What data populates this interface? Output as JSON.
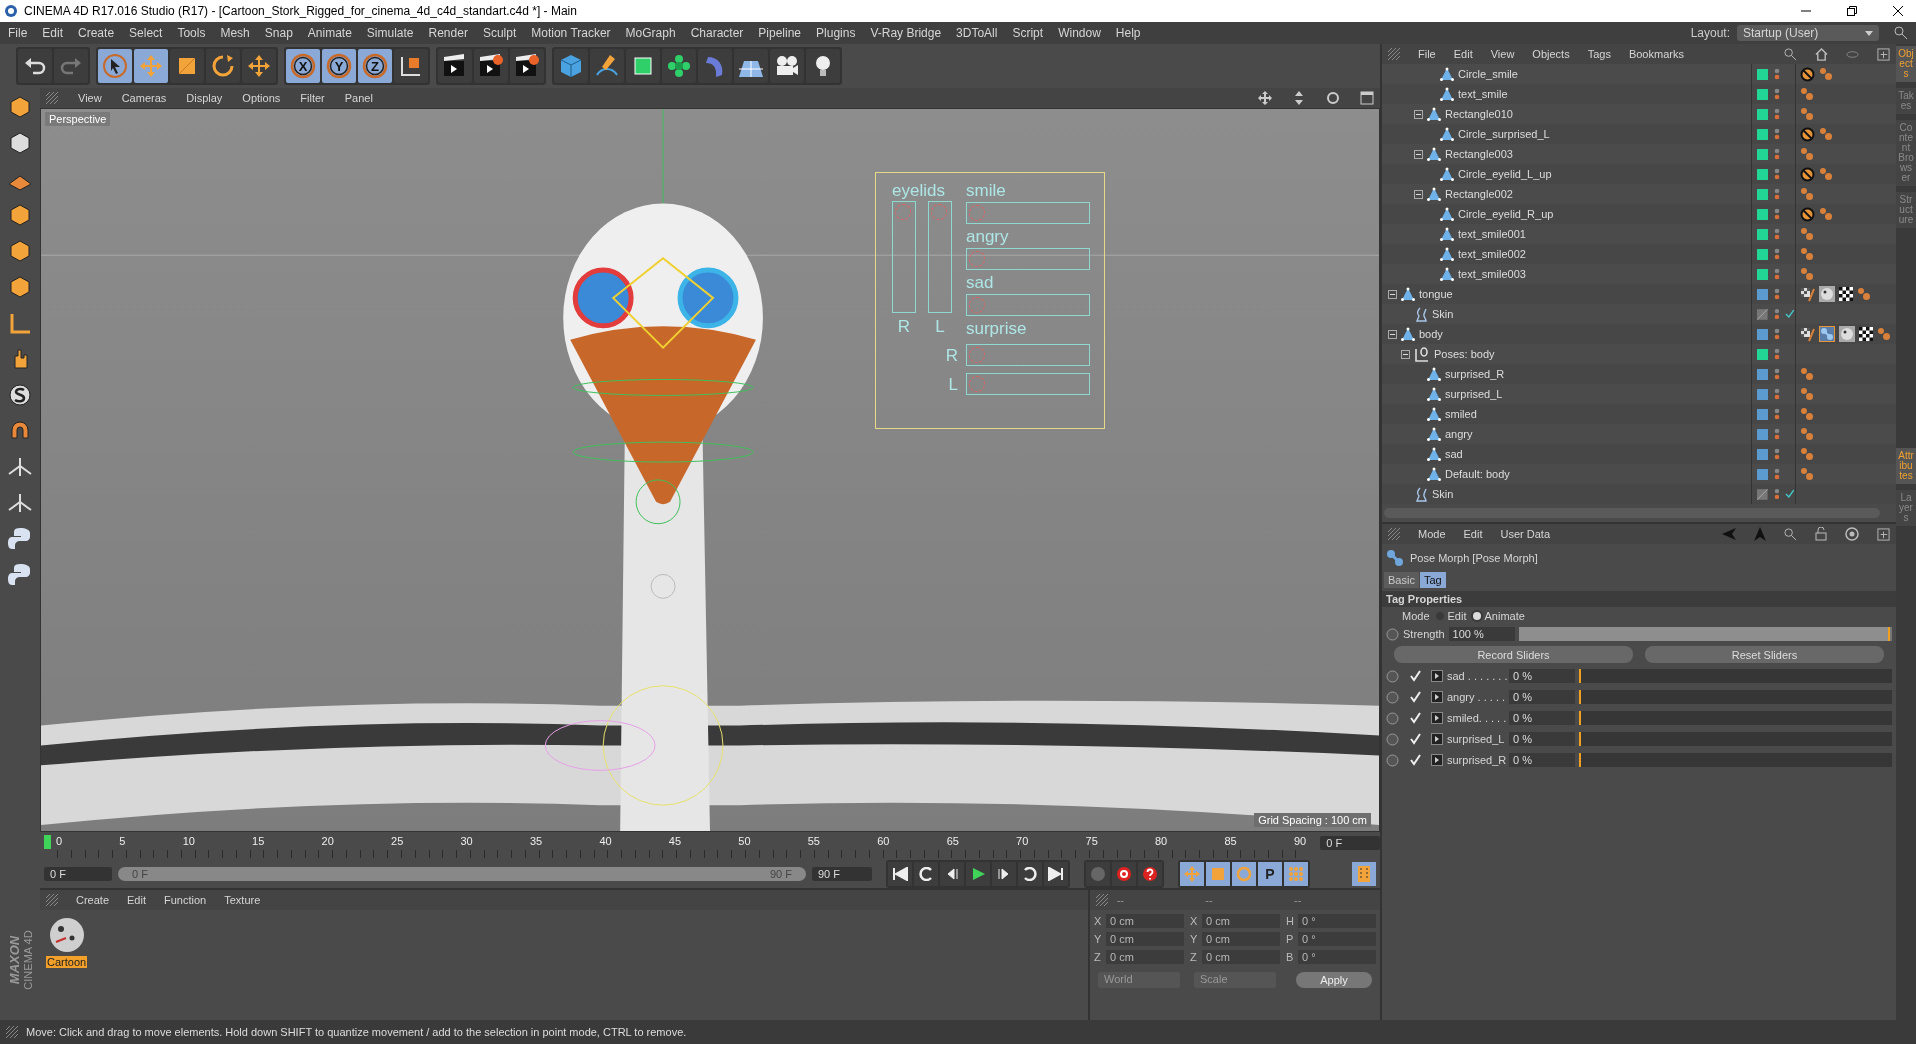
{
  "window": {
    "title": "CINEMA 4D R17.016 Studio (R17) - [Cartoon_Stork_Rigged_for_cinema_4d_c4d_standart.c4d *] - Main"
  },
  "menu_bar": [
    "File",
    "Edit",
    "Create",
    "Select",
    "Tools",
    "Mesh",
    "Snap",
    "Animate",
    "Simulate",
    "Render",
    "Sculpt",
    "Motion Tracker",
    "MoGraph",
    "Character",
    "Pipeline",
    "Plugins",
    "V-Ray Bridge",
    "3DToAll",
    "Script",
    "Window",
    "Help"
  ],
  "layout": {
    "label": "Layout:",
    "value": "Startup (User)"
  },
  "toolbar": [
    [
      {
        "kind": "undo",
        "selected": false
      },
      {
        "kind": "redo",
        "selected": false
      }
    ],
    [
      {
        "kind": "select",
        "selected": true
      },
      {
        "kind": "move",
        "selected": true
      },
      {
        "kind": "scale",
        "selected": false
      },
      {
        "kind": "rotate",
        "selected": false
      },
      {
        "kind": "move-alt",
        "selected": false
      }
    ],
    [
      {
        "kind": "axis",
        "label": "X",
        "selected": true
      },
      {
        "kind": "axis",
        "label": "Y",
        "selected": true
      },
      {
        "kind": "axis",
        "label": "Z",
        "selected": true
      },
      {
        "kind": "coords",
        "selected": false
      }
    ],
    [
      {
        "kind": "render-view",
        "selected": false
      },
      {
        "kind": "render",
        "selected": false
      },
      {
        "kind": "render-settings",
        "selected": false
      }
    ],
    [
      {
        "kind": "cube",
        "selected": false
      },
      {
        "kind": "pen",
        "selected": false
      },
      {
        "kind": "generator",
        "selected": false
      },
      {
        "kind": "array",
        "selected": false
      },
      {
        "kind": "deformer",
        "selected": false
      },
      {
        "kind": "floor",
        "selected": false
      },
      {
        "kind": "camera",
        "selected": false
      },
      {
        "kind": "light",
        "selected": false
      }
    ]
  ],
  "viewport": {
    "menu": [
      "View",
      "Cameras",
      "Display",
      "Options",
      "Filter",
      "Panel"
    ],
    "camera": "Perspective",
    "grid_spacing": "Grid Spacing : 100 cm",
    "controller": {
      "eyelids": "eyelids",
      "eyelid_sides": [
        "R",
        "L"
      ],
      "sliders": [
        "smile",
        "angry",
        "sad"
      ],
      "surprise": "surprise",
      "surprise_sides": [
        "R",
        "L"
      ]
    }
  },
  "timeline": {
    "ticks": [
      "0",
      "5",
      "10",
      "15",
      "20",
      "25",
      "30",
      "35",
      "40",
      "45",
      "50",
      "55",
      "60",
      "65",
      "70",
      "75",
      "80",
      "85",
      "90"
    ],
    "current": "0 F",
    "start": "0 F",
    "range": {
      "start": "0 F",
      "end": "90 F"
    },
    "end": "90 F",
    "key_param": "P"
  },
  "materials": {
    "menu": [
      "Create",
      "Edit",
      "Function",
      "Texture"
    ],
    "items": [
      {
        "name": "Cartoon",
        "selected": true
      }
    ]
  },
  "coordinates": {
    "headers": [
      "--",
      "--",
      "--"
    ],
    "rows": [
      [
        {
          "axis": "X",
          "value": "0 cm"
        },
        {
          "axis": "X",
          "value": "0 cm"
        },
        {
          "axis": "H",
          "value": "0 °"
        }
      ],
      [
        {
          "axis": "Y",
          "value": "0 cm"
        },
        {
          "axis": "Y",
          "value": "0 cm"
        },
        {
          "axis": "P",
          "value": "0 °"
        }
      ],
      [
        {
          "axis": "Z",
          "value": "0 cm"
        },
        {
          "axis": "Z",
          "value": "0 cm"
        },
        {
          "axis": "B",
          "value": "0 °"
        }
      ]
    ],
    "dropdowns": [
      "World",
      "Scale"
    ],
    "apply": "Apply"
  },
  "logo": {
    "line1": "MAXON",
    "line2": "CINEMA 4D"
  },
  "status_bar": "Move: Click and drag to move elements. Hold down SHIFT to quantize movement / add to the selection in point mode, CTRL to remove.",
  "object_manager": {
    "menu": [
      "File",
      "Edit",
      "View",
      "Objects",
      "Tags",
      "Bookmarks"
    ],
    "tree": [
      {
        "children": [
          {
            "children": [
              {
                "children": [
                  {
                    "name": "Circle_smile",
                    "kind": "polygon",
                    "color": "#22d796",
                    "tags": [
                      {
                        "kind": "restrict"
                      },
                      {
                        "kind": "dots"
                      }
                    ]
                  },
                  {
                    "name": "text_smile",
                    "kind": "polygon",
                    "color": "#22d796",
                    "tags": [
                      {
                        "kind": "dots"
                      }
                    ]
                  }
                ]
              },
              {
                "name": "Rectangle010",
                "kind": "polygon",
                "color": "#22d796",
                "tags": [
                  {
                    "kind": "dots"
                  }
                ],
                "children": [
                  {
                    "name": "Circle_surprised_L",
                    "kind": "polygon",
                    "color": "#22d796",
                    "tags": [
                      {
                        "kind": "restrict"
                      },
                      {
                        "kind": "dots"
                      }
                    ]
                  }
                ]
              },
              {
                "name": "Rectangle003",
                "kind": "polygon",
                "color": "#22d796",
                "tags": [
                  {
                    "kind": "dots"
                  }
                ],
                "children": [
                  {
                    "name": "Circle_eyelid_L_up",
                    "kind": "polygon",
                    "color": "#22d796",
                    "tags": [
                      {
                        "kind": "restrict"
                      },
                      {
                        "kind": "dots"
                      }
                    ]
                  }
                ]
              },
              {
                "name": "Rectangle002",
                "kind": "polygon",
                "color": "#22d796",
                "tags": [
                  {
                    "kind": "dots"
                  }
                ],
                "children": [
                  {
                    "name": "Circle_eyelid_R_up",
                    "kind": "polygon",
                    "color": "#22d796",
                    "tags": [
                      {
                        "kind": "restrict"
                      },
                      {
                        "kind": "dots"
                      }
                    ]
                  },
                  {
                    "name": "text_smile001",
                    "kind": "polygon",
                    "color": "#22d796",
                    "tags": [
                      {
                        "kind": "dots"
                      }
                    ]
                  },
                  {
                    "name": "text_smile002",
                    "kind": "polygon",
                    "color": "#22d796",
                    "tags": [
                      {
                        "kind": "dots"
                      }
                    ]
                  },
                  {
                    "name": "text_smile003",
                    "kind": "polygon",
                    "color": "#22d796",
                    "tags": [
                      {
                        "kind": "dots"
                      }
                    ]
                  }
                ]
              }
            ]
          }
        ]
      },
      {
        "name": "tongue",
        "kind": "polygon",
        "color": "#5b9bd0",
        "tags": [
          {
            "kind": "texture"
          },
          {
            "kind": "material"
          },
          {
            "kind": "checker"
          },
          {
            "kind": "dots"
          }
        ],
        "children": [
          {
            "name": "Skin",
            "kind": "skin"
          }
        ]
      },
      {
        "name": "body",
        "kind": "polygon",
        "color": "#5b9bd0",
        "tags": [
          {
            "kind": "texture"
          },
          {
            "kind": "posemorph"
          },
          {
            "kind": "material"
          },
          {
            "kind": "checker"
          },
          {
            "kind": "dots"
          }
        ],
        "children": [
          {
            "name": "Poses: body",
            "kind": "pose",
            "color": "#22d796",
            "children": [
              {
                "name": "surprised_R",
                "kind": "polygon",
                "color": "#5b9bd0",
                "tags": [
                  {
                    "kind": "dots"
                  }
                ]
              },
              {
                "name": "surprised_L",
                "kind": "polygon",
                "color": "#5b9bd0",
                "tags": [
                  {
                    "kind": "dots"
                  }
                ]
              },
              {
                "name": "smiled",
                "kind": "polygon",
                "color": "#5b9bd0",
                "tags": [
                  {
                    "kind": "dots"
                  }
                ]
              },
              {
                "name": "angry",
                "kind": "polygon",
                "color": "#5b9bd0",
                "tags": [
                  {
                    "kind": "dots"
                  }
                ]
              },
              {
                "name": "sad",
                "kind": "polygon",
                "color": "#5b9bd0",
                "tags": [
                  {
                    "kind": "dots"
                  }
                ]
              },
              {
                "name": "Default: body",
                "kind": "polygon",
                "color": "#5b9bd0",
                "tags": [
                  {
                    "kind": "dots"
                  }
                ]
              }
            ]
          },
          {
            "name": "Skin",
            "kind": "skin"
          }
        ]
      }
    ]
  },
  "side_tabs_top": [
    {
      "label": "Objects",
      "selected": true
    },
    {
      "label": "Takes",
      "selected": false
    },
    {
      "label": "Content Browser",
      "selected": false
    },
    {
      "label": "Structure",
      "selected": false
    }
  ],
  "attributes": {
    "menu": [
      "Mode",
      "Edit",
      "User Data"
    ],
    "title": "Pose Morph [Pose Morph]",
    "tabs": [
      {
        "label": "Basic",
        "selected": false
      },
      {
        "label": "Tag",
        "selected": true
      }
    ],
    "section": "Tag Properties",
    "mode": {
      "label": "Mode",
      "options": [
        {
          "label": "Edit",
          "selected": false
        },
        {
          "label": "Animate",
          "selected": true
        }
      ]
    },
    "strength": {
      "label": "Strength",
      "value": "100 %",
      "level": 1
    },
    "buttons": [
      "Record Sliders",
      "Reset Sliders"
    ],
    "morphs": [
      {
        "label": "sad . . . . . . .",
        "checked": true,
        "value": "0 %",
        "level": 0
      },
      {
        "label": "angry . . . . .",
        "checked": true,
        "value": "0 %",
        "level": 0
      },
      {
        "label": "smiled. . . . .",
        "checked": true,
        "value": "0 %",
        "level": 0
      },
      {
        "label": "surprised_L",
        "checked": true,
        "value": "0 %",
        "level": 0
      },
      {
        "label": "surprised_R",
        "checked": true,
        "value": "0 %",
        "level": 0
      }
    ]
  },
  "side_tabs_bottom": [
    {
      "label": "Attributes",
      "selected": true
    },
    {
      "label": "Layers",
      "selected": false
    }
  ]
}
